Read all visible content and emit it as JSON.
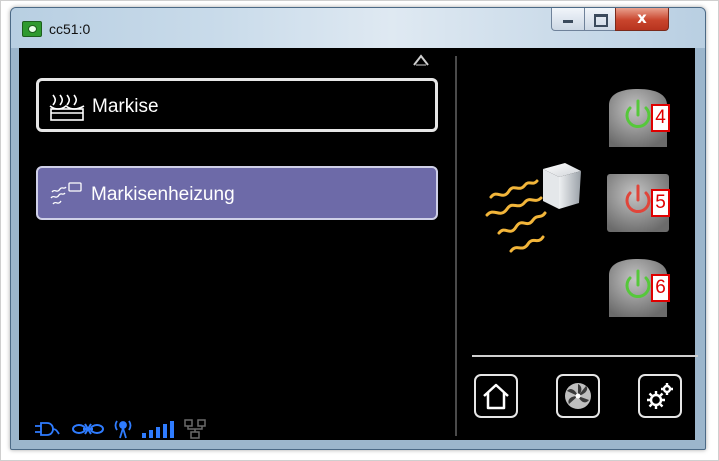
{
  "window": {
    "title": "cc51:0",
    "controls": [
      "minimize",
      "maximize",
      "close"
    ],
    "close_glyph": "x"
  },
  "menu": {
    "items": [
      {
        "label": "Markise",
        "icon": "awning-icon",
        "selected": false
      },
      {
        "label": "Markisenheizung",
        "icon": "heater-wave-icon",
        "selected": true
      }
    ]
  },
  "power_buttons": [
    {
      "number": "4",
      "state": "on",
      "color": "#56c83b"
    },
    {
      "number": "5",
      "state": "off",
      "color": "#e0453a"
    },
    {
      "number": "6",
      "state": "on",
      "color": "#56c83b"
    }
  ],
  "nav": [
    "home-icon",
    "fan-icon",
    "settings-gear-icon"
  ],
  "status_icons": [
    "plug-icon",
    "link-icon",
    "antenna-icon",
    "signal-bars-icon",
    "network-icon"
  ],
  "colors": {
    "selected_item": "#6d6aa8",
    "badge_border": "#e00000",
    "status_blue": "#2f7cff",
    "heat_waves": "#f2b53a"
  }
}
